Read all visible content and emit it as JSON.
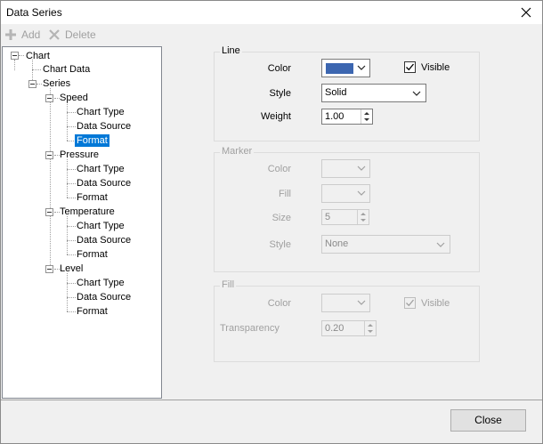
{
  "window": {
    "title": "Data Series"
  },
  "toolbar": {
    "add_label": "Add",
    "delete_label": "Delete"
  },
  "tree": {
    "root": "Chart",
    "chart_data": "Chart Data",
    "series_label": "Series",
    "series": [
      {
        "name": "Speed",
        "children": [
          "Chart Type",
          "Data Source",
          "Format"
        ]
      },
      {
        "name": "Pressure",
        "children": [
          "Chart Type",
          "Data Source",
          "Format"
        ]
      },
      {
        "name": "Temperature",
        "children": [
          "Chart Type",
          "Data Source",
          "Format"
        ]
      },
      {
        "name": "Level",
        "children": [
          "Chart Type",
          "Data Source",
          "Format"
        ]
      }
    ],
    "selected": "Speed > Format"
  },
  "line": {
    "title": "Line",
    "color_label": "Color",
    "color": "#3c66b0",
    "visible_label": "Visible",
    "visible": true,
    "style_label": "Style",
    "style": "Solid",
    "weight_label": "Weight",
    "weight": "1.00"
  },
  "marker": {
    "title": "Marker",
    "color_label": "Color",
    "fill_label": "Fill",
    "size_label": "Size",
    "size": "5",
    "style_label": "Style",
    "style": "None"
  },
  "fill": {
    "title": "Fill",
    "color_label": "Color",
    "visible_label": "Visible",
    "visible": true,
    "transparency_label": "Transparency",
    "transparency": "0.20"
  },
  "footer": {
    "close_label": "Close"
  }
}
